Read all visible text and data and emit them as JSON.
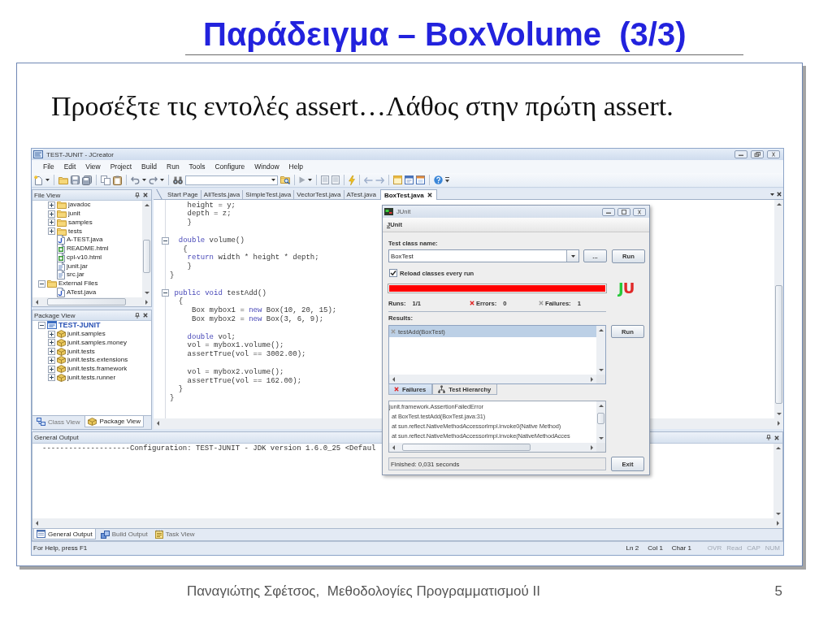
{
  "slide": {
    "title": "Παράδειγμα – BoxVolume  (3/3)",
    "text": "Προσέξτε τις εντολές assert…Λάθος στην πρώτη assert."
  },
  "ide": {
    "title": "TEST-JUNIT - JCreator",
    "menu": [
      "File",
      "Edit",
      "View",
      "Project",
      "Build",
      "Run",
      "Tools",
      "Configure",
      "Window",
      "Help"
    ],
    "file_view": {
      "title": "File View",
      "items": [
        {
          "children": [
            {
              "label": "javadoc",
              "kind": "folder",
              "expanded": false
            },
            {
              "label": "junit",
              "kind": "folder",
              "expanded": false
            },
            {
              "label": "samples",
              "kind": "folder",
              "expanded": false
            },
            {
              "label": "tests",
              "kind": "folder",
              "expanded": false
            },
            {
              "label": "A-TEST.java",
              "kind": "java"
            },
            {
              "label": "README.html",
              "kind": "html"
            },
            {
              "label": "cpl-v10.html",
              "kind": "html"
            },
            {
              "label": "junit.jar",
              "kind": "jar"
            },
            {
              "label": "src.jar",
              "kind": "jar"
            }
          ]
        },
        {
          "label": "External Files",
          "kind": "folder",
          "expanded": true,
          "children": [
            {
              "label": "ATest.java",
              "kind": "java"
            }
          ]
        }
      ]
    },
    "package_view": {
      "title": "Package View",
      "items": [
        {
          "label": "TEST-JUNIT",
          "kind": "project",
          "expanded": true,
          "children": [
            {
              "label": "junit.samples",
              "kind": "package",
              "expanded": false
            },
            {
              "label": "junit.samples.money",
              "kind": "package",
              "expanded": false
            },
            {
              "label": "junit.tests",
              "kind": "package",
              "expanded": false
            },
            {
              "label": "junit.tests.extensions",
              "kind": "package",
              "expanded": false
            },
            {
              "label": "junit.tests.framework",
              "kind": "package",
              "expanded": false
            },
            {
              "label": "junit.tests.runner",
              "kind": "package",
              "expanded": false
            }
          ]
        }
      ]
    },
    "side_tabs": [
      {
        "label": "Class View",
        "kind": "class",
        "selected": false
      },
      {
        "label": "Package View",
        "kind": "package",
        "selected": true
      }
    ],
    "editor_tabs": [
      {
        "label": "Start Page",
        "selected": false
      },
      {
        "label": "AllTests.java",
        "selected": false
      },
      {
        "label": "SimpleTest.java",
        "selected": false
      },
      {
        "label": "VectorTest.java",
        "selected": false
      },
      {
        "label": "ATest.java",
        "selected": false
      },
      {
        "label": "BoxTest.java",
        "selected": true
      }
    ],
    "code": [
      [
        {
          "fold": false,
          "tokens": [
            {
              "kind": "plain",
              "text": "    height = y;"
            }
          ]
        },
        {
          "fold": false,
          "tokens": [
            {
              "kind": "plain",
              "text": "    depth = z;"
            }
          ]
        },
        {
          "fold": false,
          "tokens": [
            {
              "kind": "plain",
              "text": "    }"
            }
          ]
        }
      ],
      [
        {
          "fold": true,
          "tokens": [
            {
              "kind": "keyword",
              "text": "  double"
            },
            {
              "kind": "plain",
              "text": " volume()"
            }
          ]
        },
        {
          "fold": false,
          "tokens": [
            {
              "kind": "plain",
              "text": "   {"
            }
          ]
        },
        {
          "fold": false,
          "tokens": [
            {
              "kind": "keyword",
              "text": "    return"
            },
            {
              "kind": "plain",
              "text": " width * height * depth;"
            }
          ]
        },
        {
          "fold": false,
          "tokens": [
            {
              "kind": "plain",
              "text": "    }"
            }
          ]
        },
        {
          "fold": false,
          "tokens": [
            {
              "kind": "plain",
              "text": "}"
            }
          ]
        }
      ],
      [
        {
          "fold": true,
          "tokens": [
            {
              "kind": "keyword",
              "text": " public void"
            },
            {
              "kind": "plain",
              "text": " testAdd()"
            }
          ]
        },
        {
          "fold": false,
          "tokens": [
            {
              "kind": "plain",
              "text": "  {"
            }
          ]
        },
        {
          "fold": false,
          "tokens": [
            {
              "kind": "plain",
              "text": "     Box mybox1 = "
            },
            {
              "kind": "keyword",
              "text": "new"
            },
            {
              "kind": "plain",
              "text": " Box(10, 20, 15);"
            }
          ]
        },
        {
          "fold": false,
          "tokens": [
            {
              "kind": "plain",
              "text": "     Box mybox2 = "
            },
            {
              "kind": "keyword",
              "text": "new"
            },
            {
              "kind": "plain",
              "text": " Box(3, 6, 9);"
            }
          ]
        }
      ],
      [
        {
          "fold": false,
          "tokens": [
            {
              "kind": "keyword",
              "text": "    double"
            },
            {
              "kind": "plain",
              "text": " vol;"
            }
          ]
        },
        {
          "fold": false,
          "tokens": [
            {
              "kind": "plain",
              "text": "    vol = mybox1.volume();"
            }
          ]
        },
        {
          "fold": false,
          "tokens": [
            {
              "kind": "plain",
              "text": "    assertTrue(vol == 3002.00);"
            }
          ]
        }
      ],
      [
        {
          "fold": false,
          "tokens": [
            {
              "kind": "plain",
              "text": "    vol = mybox2.volume();"
            }
          ]
        },
        {
          "fold": false,
          "tokens": [
            {
              "kind": "plain",
              "text": "    assertTrue(vol == 162.00);"
            }
          ]
        },
        {
          "fold": false,
          "tokens": [
            {
              "kind": "plain",
              "text": "  }"
            }
          ]
        },
        {
          "fold": false,
          "tokens": [
            {
              "kind": "plain",
              "text": "}"
            }
          ]
        }
      ]
    ],
    "output": {
      "title": "General Output",
      "lines": [
        "--------------------Configuration: TEST-JUNIT - JDK version 1.6.0_25 <Defaul"
      ]
    },
    "output_tabs": [
      {
        "label": "General Output",
        "kind": "general",
        "selected": true
      },
      {
        "label": "Build Output",
        "kind": "build",
        "selected": false
      },
      {
        "label": "Task View",
        "kind": "tasks",
        "selected": false
      }
    ],
    "status_bar": {
      "hint": "For Help, press F1",
      "position": [
        "Ln 2",
        "Col 1",
        "Char 1"
      ],
      "indicators": [
        {
          "label": "OVR",
          "on": false
        },
        {
          "label": "Read",
          "on": false
        },
        {
          "label": "CAP",
          "on": false
        },
        {
          "label": "NUM",
          "on": false
        }
      ]
    },
    "junit_window": {
      "title": "JUnit",
      "menu": [
        "JUnit"
      ],
      "class_label": "Test class name:",
      "class_field": {
        "value": "BoxTest"
      },
      "browse_button": "...",
      "run_button": "Run",
      "reload": {
        "label": "Reload classes every run",
        "checked": true
      },
      "progress": {
        "level": 1,
        "failed": true
      },
      "logo": "JU",
      "counters": [
        {
          "kind": "runs",
          "label": "Runs:",
          "value": "1/1"
        },
        {
          "kind": "errors",
          "label": "Errors:",
          "value": "0"
        },
        {
          "kind": "failures",
          "label": "Failures:",
          "value": "1"
        }
      ],
      "results_label": "Results:",
      "results": [
        {
          "label": "testAdd(BoxTest)",
          "kind": "failure",
          "selected": true
        }
      ],
      "results_run_button": "Run",
      "tabs": [
        {
          "label": "Failures",
          "kind": "failures",
          "selected": true
        },
        {
          "label": "Test Hierarchy",
          "kind": "hierarchy",
          "selected": false
        }
      ],
      "trace": {
        "error": "junit.framework.AssertionFailedError",
        "frames": [
          "at BoxTest.testAdd(BoxTest.java:31)",
          "at sun.reflect.NativeMethodAccessorImpl.invoke0(Native Method)",
          "at sun.reflect.NativeMethodAccessorImpl.invoke(NativeMethodAcces"
        ]
      },
      "status": "Finished: 0,031 seconds",
      "exit_button": "Exit"
    }
  },
  "footer": {
    "text": "Παναγιώτης Σφέτσος,  Μεθοδολογίες Προγραμματισμού II",
    "page": "5"
  }
}
